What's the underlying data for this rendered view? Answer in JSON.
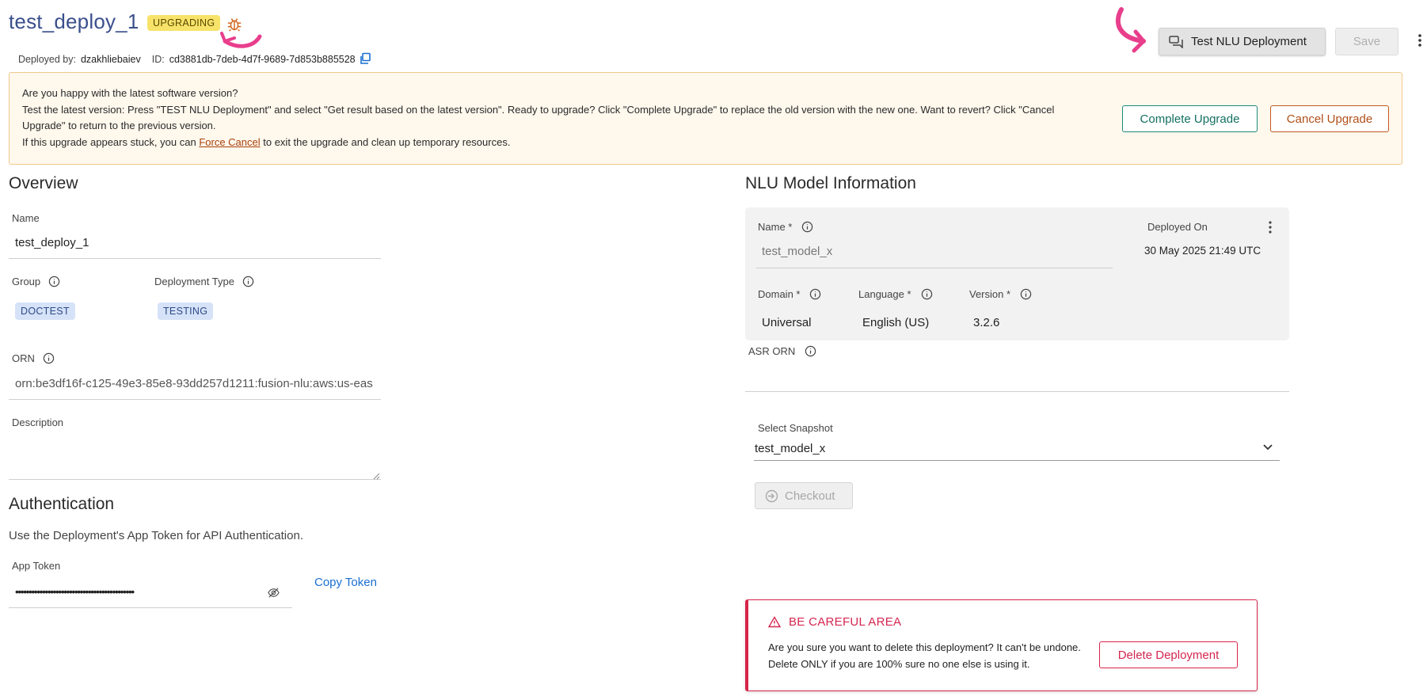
{
  "header": {
    "title": "test_deploy_1",
    "status_badge": "UPGRADING",
    "deployed_by_label": "Deployed by:",
    "deployed_by": "dzakhliebaiev",
    "id_label": "ID:",
    "id_value": "cd3881db-7deb-4d7f-9689-7d853b885528",
    "test_button": "Test NLU Deployment",
    "save_button": "Save"
  },
  "banner": {
    "line1": "Are you happy with the latest software version?",
    "line2": "Test the latest version: Press \"TEST NLU Deployment\" and select \"Get result based on the latest version\". Ready to upgrade? Click \"Complete Upgrade\" to replace the old version with the new one. Want to revert? Click \"Cancel Upgrade\" to return to the previous version.",
    "line3_prefix": "If this upgrade appears stuck, you can",
    "force_cancel_link": "Force Cancel",
    "line3_suffix": "to exit the upgrade and clean up temporary resources.",
    "complete_button": "Complete Upgrade",
    "cancel_button": "Cancel Upgrade"
  },
  "overview": {
    "heading": "Overview",
    "name_label": "Name",
    "name_value": "test_deploy_1",
    "group_label": "Group",
    "group_value": "DOCTEST",
    "deployment_type_label": "Deployment Type",
    "deployment_type_value": "TESTING",
    "orn_label": "ORN",
    "orn_value": "orn:be3df16f-c125-49e3-85e8-93dd257d1211:fusion-nlu:aws:us-eas",
    "description_label": "Description"
  },
  "authentication": {
    "heading": "Authentication",
    "subtitle": "Use the Deployment's App Token for API Authentication.",
    "app_token_label": "App Token",
    "app_token_masked": "••••••••••••••••••••••••••••••••••••••••••••",
    "copy_token": "Copy Token"
  },
  "nlu": {
    "heading": "NLU Model Information",
    "name_label": "Name *",
    "name_value": "test_model_x",
    "deployed_on_label": "Deployed On",
    "deployed_on_value": "30 May 2025 21:49 UTC",
    "domain_label": "Domain *",
    "domain_value": "Universal",
    "language_label": "Language *",
    "language_value": "English (US)",
    "version_label": "Version *",
    "version_value": "3.2.6",
    "asr_orn_label": "ASR ORN",
    "select_snapshot_label": "Select Snapshot",
    "select_snapshot_value": "test_model_x",
    "checkout_button": "Checkout"
  },
  "danger": {
    "title": "BE CAREFUL AREA",
    "text": "Are you sure you want to delete this deployment? It can't be undone. Delete ONLY if you are 100% sure no one else is using it.",
    "delete_button": "Delete Deployment"
  },
  "colors": {
    "title": "#3a4f8c",
    "badge": "#f7e36a",
    "annotation_arrow": "#e83e8c",
    "complete": "#137060",
    "cancel": "#b0501a",
    "danger": "#d8244a",
    "link": "#1a6fd1"
  },
  "icons": [
    "bug-icon",
    "copy-icon",
    "chat-icon",
    "kebab-icon",
    "info-icon",
    "eye-off-icon",
    "chevron-down-icon",
    "checkout-icon",
    "warning-icon"
  ]
}
